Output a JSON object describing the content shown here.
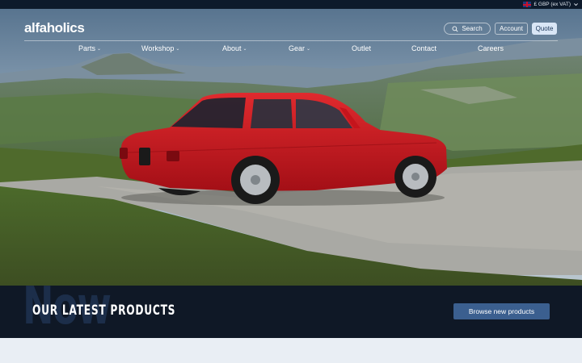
{
  "topbar": {
    "currency_label": "£ GBP (ex VAT)",
    "flag": "uk-flag-icon"
  },
  "header": {
    "logo": "alfaholics",
    "search_label": "Search",
    "account_label": "Account",
    "quote_label": "Quote"
  },
  "nav": {
    "items": [
      {
        "label": "Parts",
        "dropdown": true
      },
      {
        "label": "Workshop",
        "dropdown": true
      },
      {
        "label": "About",
        "dropdown": true
      },
      {
        "label": "Gear",
        "dropdown": true
      },
      {
        "label": "Outlet",
        "dropdown": false
      },
      {
        "label": "Contact",
        "dropdown": false
      },
      {
        "label": "Careers",
        "dropdown": false
      }
    ]
  },
  "products_band": {
    "background_word": "Now",
    "title": "OUR LATEST PRODUCTS",
    "button_label": "Browse new products"
  },
  "colors": {
    "topbar": "#0d1a2b",
    "band": "#0f1826",
    "button": "#3b5f8f",
    "car_red": "#c5141c"
  }
}
